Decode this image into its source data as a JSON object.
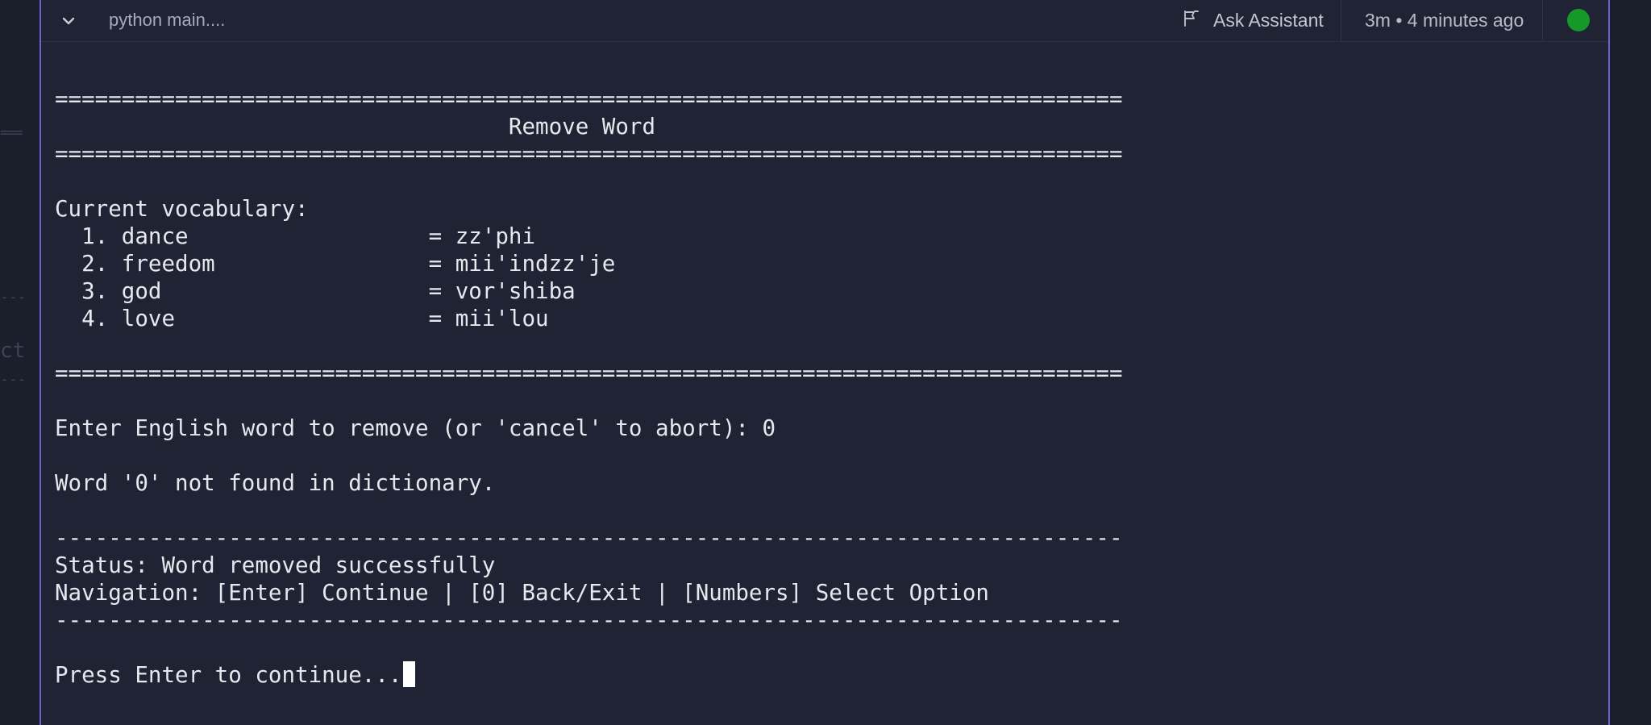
{
  "gutter": {
    "ghost_lines": [
      "===",
      "---",
      "ct",
      "---"
    ]
  },
  "header": {
    "command": "python main....",
    "assistant_label": "Ask Assistant",
    "time": "3m • 4 minutes ago",
    "status_color": "#159a2a"
  },
  "colors": {
    "accent_border": "#6d60d8",
    "cursor": "#ffffff"
  },
  "terminal": {
    "lines": [
      "================================================================================",
      "                                  Remove Word",
      "================================================================================",
      "",
      "Current vocabulary:",
      "  1. dance                  = zz'phi",
      "  2. freedom                = mii'indzz'je",
      "  3. god                    = vor'shiba",
      "  4. love                   = mii'lou",
      "",
      "================================================================================",
      "",
      "Enter English word to remove (or 'cancel' to abort): 0",
      "",
      "Word '0' not found in dictionary.",
      "",
      "--------------------------------------------------------------------------------",
      "Status: Word removed successfully",
      "Navigation: [Enter] Continue | [0] Back/Exit | [Numbers] Select Option",
      "--------------------------------------------------------------------------------",
      "",
      "Press Enter to continue..."
    ]
  }
}
